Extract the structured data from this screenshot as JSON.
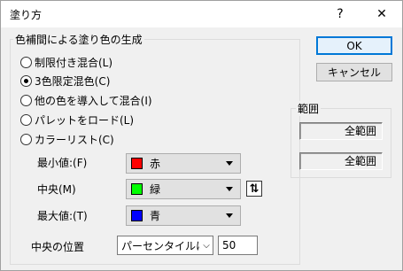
{
  "window": {
    "title": "塗り方",
    "help_glyph": "?",
    "close_glyph": "✕"
  },
  "method_group": {
    "legend": "色補間による塗り色の生成",
    "options": [
      {
        "label": "制限付き混合(L)",
        "checked": false
      },
      {
        "label": "3色限定混色(C)",
        "checked": true
      },
      {
        "label": "他の色を導入して混合(I)",
        "checked": false
      },
      {
        "label": "パレットをロード(L)",
        "checked": false
      },
      {
        "label": "カラーリスト(C)",
        "checked": false
      }
    ]
  },
  "colors": {
    "min": {
      "label": "最小値:(F)",
      "value": "赤",
      "swatch": "#ff0000"
    },
    "center": {
      "label": "中央(M)",
      "value": "緑",
      "swatch": "#00ff00"
    },
    "max": {
      "label": "最大値:(T)",
      "value": "青",
      "swatch": "#0000ff"
    },
    "swap_icon": "⇅"
  },
  "center_position": {
    "label": "中央の位置",
    "mode": "パーセンタイルに",
    "value": "50"
  },
  "buttons": {
    "ok": "OK",
    "cancel": "キャンセル"
  },
  "range_group": {
    "legend": "範囲",
    "field1": "全範囲",
    "field2": "全範囲"
  }
}
